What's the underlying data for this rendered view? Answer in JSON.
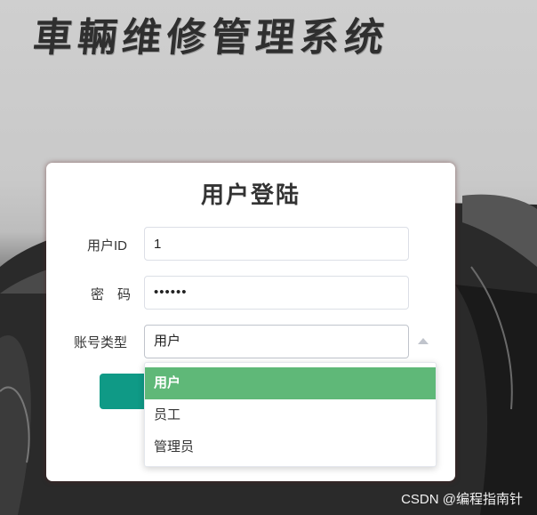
{
  "app_title": "車輛维修管理系统",
  "login": {
    "title": "用户登陆",
    "fields": {
      "user_id": {
        "label": "用户ID",
        "value": "1"
      },
      "password": {
        "label": "密　码",
        "value": "••••••"
      },
      "account_type": {
        "label": "账号类型",
        "value": "用户"
      }
    },
    "account_type_options": [
      "用户",
      "员工",
      "管理员"
    ],
    "selected_option": "用户"
  },
  "watermark": "CSDN @编程指南针",
  "colors": {
    "button": "#0f9a86",
    "selected_option_bg": "#5fb878"
  }
}
